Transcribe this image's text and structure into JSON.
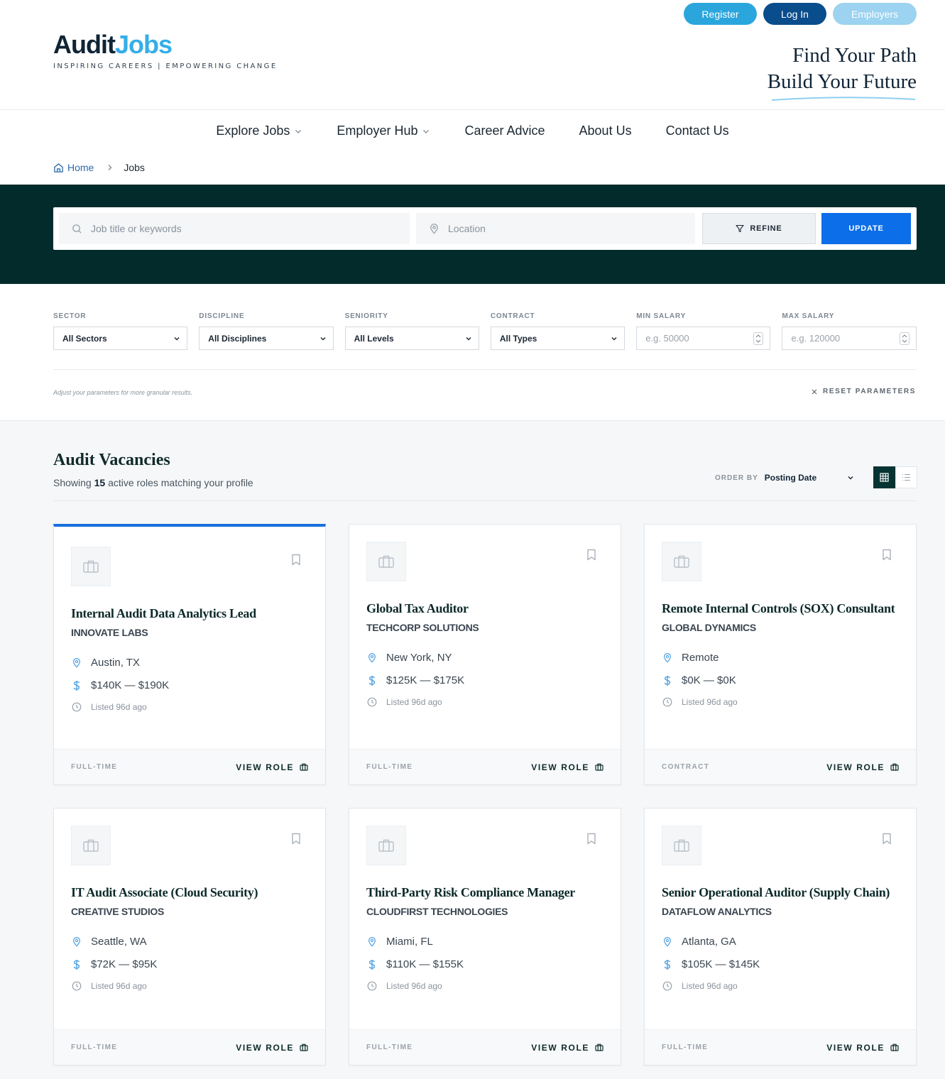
{
  "header": {
    "actions": {
      "register": "Register",
      "login": "Log In",
      "employers": "Employers"
    },
    "logo": {
      "part1": "Audit",
      "part2": "Jobs",
      "tagline": "INSPIRING CAREERS | EMPOWERING CHANGE"
    },
    "slogan": {
      "line1": "Find Your Path",
      "line2": "Build Your Future"
    }
  },
  "nav": {
    "items": [
      {
        "label": "Explore Jobs",
        "dropdown": true
      },
      {
        "label": "Employer Hub",
        "dropdown": true
      },
      {
        "label": "Career Advice",
        "dropdown": false
      },
      {
        "label": "About Us",
        "dropdown": false
      },
      {
        "label": "Contact Us",
        "dropdown": false
      }
    ]
  },
  "breadcrumb": {
    "home": "Home",
    "current": "Jobs"
  },
  "search": {
    "keywords_placeholder": "Job title or keywords",
    "location_placeholder": "Location",
    "refine_label": "REFINE",
    "update_label": "UPDATE"
  },
  "filters": {
    "sector": {
      "label": "SECTOR",
      "value": "All Sectors"
    },
    "discipline": {
      "label": "DISCIPLINE",
      "value": "All Disciplines"
    },
    "seniority": {
      "label": "SENIORITY",
      "value": "All Levels"
    },
    "contract": {
      "label": "CONTRACT",
      "value": "All Types"
    },
    "min_salary": {
      "label": "MIN SALARY",
      "placeholder": "e.g. 50000"
    },
    "max_salary": {
      "label": "MAX SALARY",
      "placeholder": "e.g. 120000"
    },
    "hint": "Adjust your parameters for more granular results.",
    "reset_label": "RESET PARAMETERS"
  },
  "results": {
    "title": "Audit Vacancies",
    "count_prefix": "Showing",
    "count": "15",
    "count_suffix": "active roles matching your profile",
    "order_label": "ORDER BY",
    "order_value": "Posting Date",
    "view_mode": "grid"
  },
  "colors": {
    "accent": "#0d6ee9",
    "brand_dark": "#032b2b",
    "brand_blue": "#35aee8"
  },
  "jobs": [
    {
      "title": "Internal Audit Data Analytics Lead",
      "company": "INNOVATE LABS",
      "location": "Austin, TX",
      "salary": "$140K — $190K",
      "listed": "Listed 96d ago",
      "type": "FULL-TIME",
      "cta": "VIEW ROLE",
      "active": true
    },
    {
      "title": "Global Tax Auditor",
      "company": "TECHCORP SOLUTIONS",
      "location": "New York, NY",
      "salary": "$125K — $175K",
      "listed": "Listed 96d ago",
      "type": "FULL-TIME",
      "cta": "VIEW ROLE",
      "active": false
    },
    {
      "title": "Remote Internal Controls (SOX) Consultant",
      "company": "GLOBAL DYNAMICS",
      "location": "Remote",
      "salary": "$0K — $0K",
      "listed": "Listed 96d ago",
      "type": "CONTRACT",
      "cta": "VIEW ROLE",
      "active": false
    },
    {
      "title": "IT Audit Associate (Cloud Security)",
      "company": "CREATIVE STUDIOS",
      "location": "Seattle, WA",
      "salary": "$72K — $95K",
      "listed": "Listed 96d ago",
      "type": "FULL-TIME",
      "cta": "VIEW ROLE",
      "active": false
    },
    {
      "title": "Third-Party Risk Compliance Manager",
      "company": "CLOUDFIRST TECHNOLOGIES",
      "location": "Miami, FL",
      "salary": "$110K — $155K",
      "listed": "Listed 96d ago",
      "type": "FULL-TIME",
      "cta": "VIEW ROLE",
      "active": false
    },
    {
      "title": "Senior Operational Auditor (Supply Chain)",
      "company": "DATAFLOW ANALYTICS",
      "location": "Atlanta, GA",
      "salary": "$105K — $145K",
      "listed": "Listed 96d ago",
      "type": "FULL-TIME",
      "cta": "VIEW ROLE",
      "active": false
    }
  ]
}
